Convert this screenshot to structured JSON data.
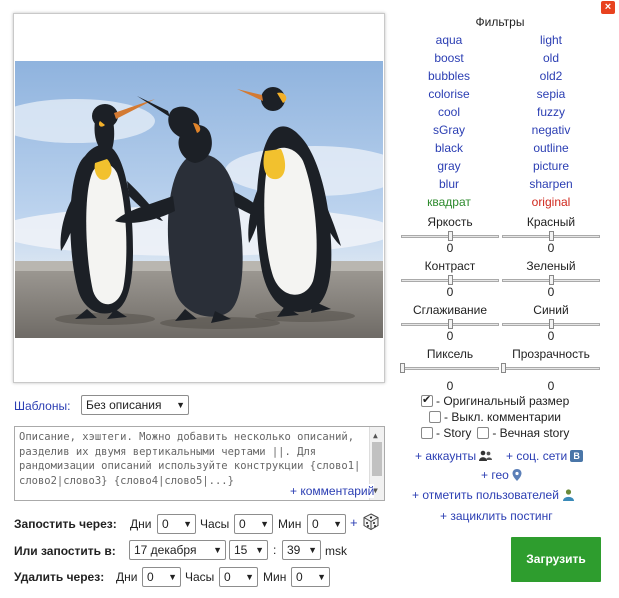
{
  "close_label": "×",
  "filters": {
    "title": "Фильтры",
    "left": [
      {
        "label": "aqua"
      },
      {
        "label": "boost"
      },
      {
        "label": "bubbles"
      },
      {
        "label": "colorise"
      },
      {
        "label": "cool"
      },
      {
        "label": "sGray"
      },
      {
        "label": "black"
      },
      {
        "label": "gray"
      },
      {
        "label": "blur"
      },
      {
        "label": "квадрат",
        "color": "green"
      }
    ],
    "right": [
      {
        "label": "light"
      },
      {
        "label": "old"
      },
      {
        "label": "old2"
      },
      {
        "label": "sepia"
      },
      {
        "label": "fuzzy"
      },
      {
        "label": "negativ"
      },
      {
        "label": "outline"
      },
      {
        "label": "picture"
      },
      {
        "label": "sharpen"
      },
      {
        "label": "original",
        "color": "red"
      }
    ]
  },
  "sliders": {
    "brightness": {
      "label": "Яркость",
      "value": "0",
      "position": 0.5
    },
    "red": {
      "label": "Красный",
      "value": "0",
      "position": 0.5
    },
    "contrast": {
      "label": "Контраст",
      "value": "0",
      "position": 0.5
    },
    "green": {
      "label": "Зеленый",
      "value": "0",
      "position": 0.5
    },
    "smoothing": {
      "label": "Сглаживание",
      "value": "0",
      "position": 0.5
    },
    "blue": {
      "label": "Синий",
      "value": "0",
      "position": 0.5
    },
    "pixel": {
      "label": "Пиксель",
      "value": "0",
      "position": 0.0
    },
    "transparency": {
      "label": "Прозрачность",
      "value": "0",
      "position": 0.0
    }
  },
  "options": {
    "original_size": {
      "label": "- Оригинальный размер",
      "checked": true
    },
    "disable_comments": {
      "label": "- Выкл. комментарии",
      "checked": false
    },
    "story": {
      "label": "- Story",
      "checked": false
    },
    "eternal_story": {
      "label": "- Вечная story",
      "checked": false
    }
  },
  "links": {
    "accounts": "+ аккаунты",
    "social": "+ соц. сети",
    "vk_badge": "B",
    "geo": "+ гео",
    "tag_users": "+ отметить пользователей",
    "loop_posting": "+ зациклить постинг"
  },
  "upload_label": "Загрузить",
  "templates": {
    "label": "Шаблоны:",
    "selected": "Без описания"
  },
  "description": {
    "text": "Описание, хэштеги. Можно добавить несколько описаний, разделив их двумя вертикальными чертами ||. Для рандомизации описаний используйте конструкции {слово1|слово2|слово3} {слово4|слово5|...}",
    "comment_link": "+ комментарий"
  },
  "post_after": {
    "label": "Запостить через:",
    "days_label": "Дни",
    "days_value": "0",
    "hours_label": "Часы",
    "hours_value": "0",
    "minutes_label": "Мин",
    "minutes_value": "0",
    "plus": "+"
  },
  "post_at": {
    "label": "Или запостить в:",
    "date": "17 декабря",
    "hour": "15",
    "separator": ":",
    "minute": "39",
    "timezone": "msk"
  },
  "delete_after": {
    "label": "Удалить через:",
    "days_label": "Дни",
    "days_value": "0",
    "hours_label": "Часы",
    "hours_value": "0",
    "minutes_label": "Мин",
    "minutes_value": "0"
  }
}
